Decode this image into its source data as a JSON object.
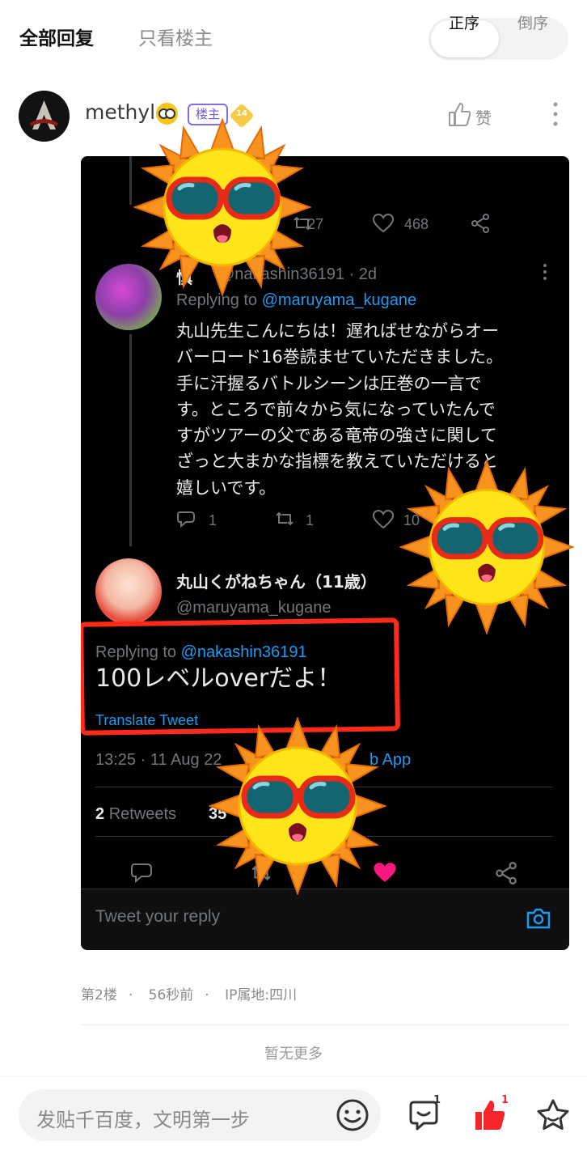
{
  "tabs": {
    "all": "全部回复",
    "op_only": "只看楼主"
  },
  "sort": {
    "asc": "正序",
    "desc": "倒序",
    "active": "asc"
  },
  "post": {
    "username": "methyl",
    "op_badge": "楼主",
    "level": "14",
    "like_label": "赞",
    "floor": "第2楼",
    "time": "56秒前",
    "ip": "IP属地:四川"
  },
  "tweet": {
    "top_stats": {
      "retweets": "27",
      "likes": "468"
    },
    "reply1": {
      "name": "慎",
      "handle": "@nakashin36191 · 2d",
      "replying_label": "Replying to ",
      "replying_to": "@maruyama_kugane",
      "body": [
        "丸山先生こんにちは！遅ればせながらオー",
        "バーロード16巻読ませていただきました。",
        "手に汗握るバトルシーンは圧巻の一言で",
        "す。ところで前々から気になっていたんで",
        "すがツアーの父である竜帝の強さに関して",
        "ざっと大まかな指標を教えていただけると",
        "嬉しいです。"
      ],
      "replies": "1",
      "retweets": "1",
      "likes": "10"
    },
    "main": {
      "name": "丸山くがねちゃん（11歳）",
      "handle": "@maruyama_kugane",
      "replying_label": "Replying to ",
      "replying_to": "@nakashin36191",
      "text": "100レベルoverだよ！",
      "translate": "Translate Tweet",
      "timestamp": "13:25 · 11 Aug 22",
      "source": "b App",
      "retweets_count": "2",
      "retweets_label": "Retweets",
      "likes_count": "35"
    },
    "reply_placeholder": "Tweet your reply"
  },
  "footer": {
    "no_more": "暂无更多"
  },
  "bottom": {
    "compose_placeholder": "发贴千百度，文明第一步",
    "comment_count": "1",
    "like_count": "1"
  },
  "colors": {
    "accent_purple": "#6d5ce0",
    "twitter_blue": "#1d9bf0",
    "like_red": "#f4262b"
  }
}
